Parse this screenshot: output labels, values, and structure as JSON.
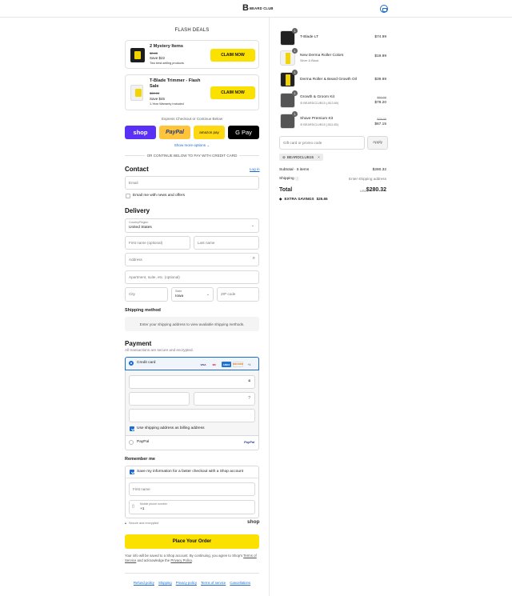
{
  "header": {
    "logo_mark": "B",
    "logo_text": "BEARD CLUB",
    "cart_icon": "shopping-bag-icon"
  },
  "flash_deals": {
    "title": "FLASH DEALS",
    "deals": [
      {
        "name": "2 Mystery Items",
        "original_price": "$0.43",
        "save": "Save $22",
        "note": "Two best-selling products",
        "button": "CLAIM NOW"
      },
      {
        "name": "T-Blade Trimmer - Flash Sale",
        "original_price": "$60.00",
        "save": "Save $45",
        "note": "1-Year Warranty Included",
        "button": "CLAIM NOW"
      }
    ]
  },
  "express": {
    "label": "Express Checkout or Continue Below",
    "shop": "shop",
    "paypal": "PayPal",
    "amazon": "amazon pay",
    "gpay": "G Pay",
    "more": "Show more options ⌄",
    "or_continue": "OR CONTINUE BELOW TO PAY WITH CREDIT CARD"
  },
  "contact": {
    "title": "Contact",
    "login": "Log in",
    "email_placeholder": "Email",
    "news_label": "Email me with news and offers"
  },
  "delivery": {
    "title": "Delivery",
    "country_label": "Country/Region",
    "country_value": "United States",
    "first_name": "First name (optional)",
    "last_name": "Last name",
    "address": "Address",
    "apartment": "Apartment, suite, etc. (optional)",
    "city": "City",
    "state_label": "State",
    "state_value": "Iowa",
    "zip": "ZIP code"
  },
  "shipping_method": {
    "title": "Shipping method",
    "message": "Enter your shipping address to view available shipping methods."
  },
  "payment": {
    "title": "Payment",
    "subtitle": "All transactions are secure and encrypted.",
    "credit_card": "Credit card",
    "cards": [
      "VISA",
      "MC",
      "AMEX",
      "DISCOVER",
      "+4"
    ],
    "billing_same": "Use shipping address as billing address",
    "paypal": "PayPal",
    "paypal_logo": "PayPal"
  },
  "remember": {
    "title": "Remember me",
    "save_label": "Save my information for a faster checkout with a Shop account",
    "first_name": "First name",
    "phone_label": "Mobile phone number",
    "phone_value": "+1",
    "secure": "Secure and encrypted",
    "shop_logo": "shop"
  },
  "place_order": "Place Your Order",
  "legal": {
    "text1": "Your info will be saved to a Shop account. By continuing, you agree to Shop's",
    "terms": "Terms of Service",
    "text2": "and acknowledge the",
    "privacy": "Privacy Policy",
    "period": "."
  },
  "footer_links": [
    "Refund policy",
    "Shipping",
    "Privacy policy",
    "Terms of service",
    "Cancellations"
  ],
  "order": {
    "items": [
      {
        "qty": "1",
        "name": "T-Blade LT",
        "variant": "",
        "discount": "",
        "price": "$74.99",
        "original": ""
      },
      {
        "qty": "1",
        "name": "New Derma Roller Colors",
        "variant": "Silver & Black",
        "discount": "",
        "price": "$19.99",
        "original": ""
      },
      {
        "qty": "1",
        "name": "Derma Roller & Beard Growth Oil",
        "variant": "",
        "discount": "",
        "price": "$39.99",
        "original": ""
      },
      {
        "qty": "1",
        "name": "Growth & Groom Kit",
        "variant": "",
        "discount": "BEARDCLUB15 (-$13.80)",
        "price": "$78.20",
        "original": "$92.00"
      },
      {
        "qty": "1",
        "name": "Shave Premium Kit",
        "variant": "",
        "discount": "BEARDCLUB15 (-$11.85)",
        "price": "$67.15",
        "original": "$79.00"
      }
    ],
    "discount_placeholder": "Gift card or promo code",
    "apply": "Apply",
    "applied_code": "BEARDCLUB15",
    "subtotal_label": "Subtotal · 5 items",
    "subtotal": "$280.32",
    "shipping_label": "Shipping",
    "shipping_value": "Enter shipping address",
    "total_label": "Total",
    "currency": "USD",
    "total": "$280.32",
    "savings_label": "EXTRA SAVINGS",
    "savings": "$25.65"
  }
}
